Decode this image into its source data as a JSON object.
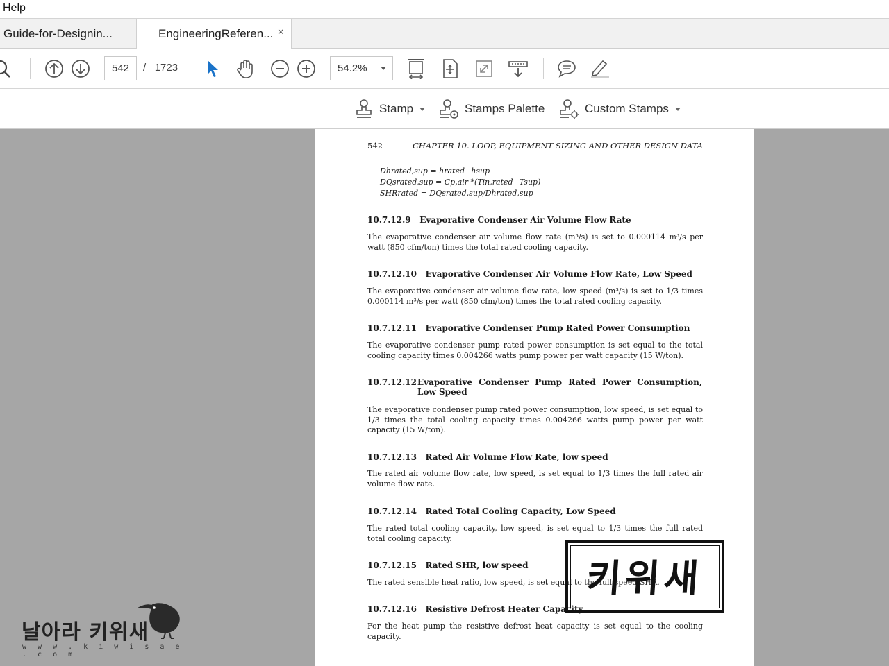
{
  "menu": {
    "help": "Help"
  },
  "tabs": [
    {
      "label": "Guide-for-Designin..."
    },
    {
      "label": "EngineeringReferen...",
      "close": "×"
    }
  ],
  "toolbar": {
    "page_current": "542",
    "page_sep": "/",
    "page_total": "1723",
    "zoom": "54.2%"
  },
  "stampbar": {
    "stamp": "Stamp",
    "palette": "Stamps Palette",
    "custom": "Custom Stamps"
  },
  "document": {
    "page_number": "542",
    "chapter": "CHAPTER 10.  LOOP, EQUIPMENT SIZING AND OTHER DESIGN DATA",
    "equations": [
      "Dhrated,sup = hrated−hsup",
      "DQsrated,sup = Cp,air *(Tin,rated−Tsup)",
      "SHRrated = DQsrated,sup/Dhrated,sup"
    ],
    "sections": [
      {
        "number": "10.7.12.9",
        "title": "Evaporative Condenser Air Volume Flow Rate",
        "body": "The evaporative condenser air volume flow rate (m³/s) is set to 0.000114 m³/s per watt (850 cfm/ton) times the total rated cooling capacity."
      },
      {
        "number": "10.7.12.10",
        "title": "Evaporative Condenser Air Volume Flow Rate, Low Speed",
        "body": "The evaporative condenser air volume flow rate, low speed (m³/s) is set to 1/3 times 0.000114 m³/s per watt (850 cfm/ton) times the total rated cooling capacity."
      },
      {
        "number": "10.7.12.11",
        "title": "Evaporative Condenser Pump Rated Power Consumption",
        "body": "The evaporative condenser pump rated power consumption is set equal to the total cooling capacity times 0.004266 watts pump power per watt capacity (15 W/ton)."
      },
      {
        "number": "10.7.12.12",
        "title": "Evaporative Condenser Pump Rated Power Consumption, Low Speed",
        "body": "The evaporative condenser pump rated power consumption, low speed, is set equal to 1/3 times the total cooling capacity times 0.004266 watts pump power per watt capacity (15 W/ton)."
      },
      {
        "number": "10.7.12.13",
        "title": "Rated Air Volume Flow Rate, low speed",
        "body": "The rated air volume flow rate, low speed, is set equal to 1/3 times the full rated air volume flow rate."
      },
      {
        "number": "10.7.12.14",
        "title": "Rated Total Cooling Capacity, Low Speed",
        "body": "The rated total cooling capacity, low speed, is set equal to 1/3 times the full rated total cooling capacity."
      },
      {
        "number": "10.7.12.15",
        "title": "Rated SHR, low speed",
        "body": "The rated sensible heat ratio, low speed, is set equal to the full speed SHR."
      },
      {
        "number": "10.7.12.16",
        "title": "Resistive Defrost Heater Capacity",
        "body": "For the heat pump the resistive defrost heat capacity is set equal to the cooling capacity."
      }
    ]
  },
  "stamp_overlay": {
    "text": "키위새"
  },
  "watermark": {
    "title": "날아라 키위새",
    "url": "w w w . k i w i s a e . c o m"
  }
}
